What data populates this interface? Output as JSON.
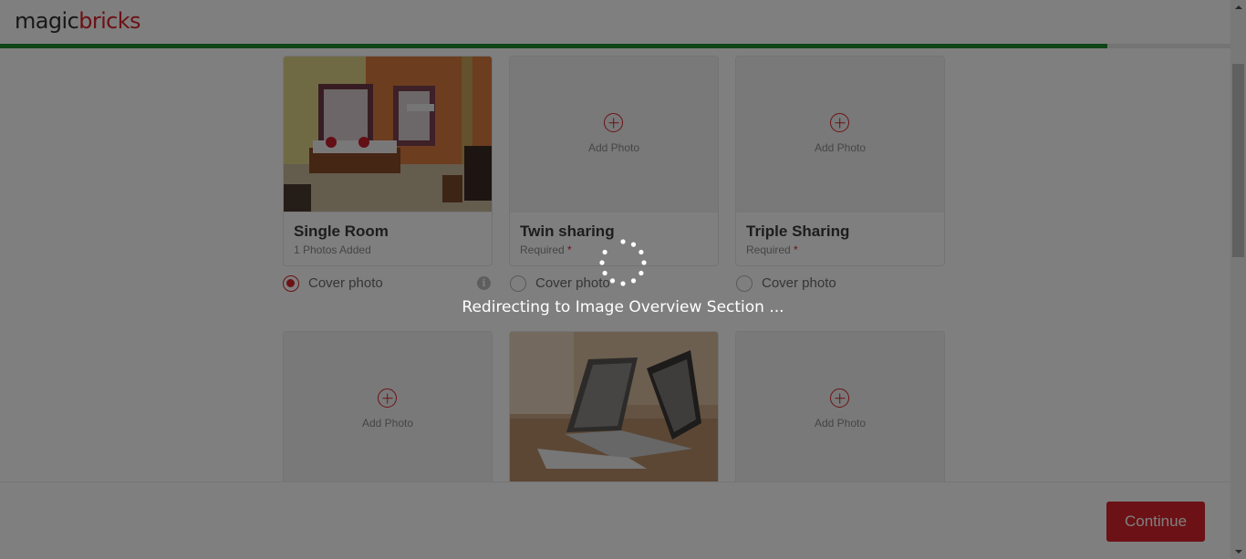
{
  "header": {
    "logo_part1": "magic",
    "logo_part2": "bricks",
    "progress_percent": 90
  },
  "photo_cards": [
    {
      "title": "Single Room",
      "subtitle": "1 Photos Added",
      "required_mark": "",
      "has_photo": true,
      "photo_desc": "bedroom-photo"
    },
    {
      "title": "Twin sharing",
      "subtitle": "Required",
      "required_mark": "*",
      "has_photo": false,
      "add_label": "Add Photo"
    },
    {
      "title": "Triple Sharing",
      "subtitle": "Required",
      "required_mark": "*",
      "has_photo": false,
      "add_label": "Add Photo"
    },
    {
      "has_photo": false,
      "add_label": "Add Photo"
    },
    {
      "has_photo": true,
      "photo_desc": "laptop-photo"
    },
    {
      "has_photo": false,
      "add_label": "Add Photo"
    }
  ],
  "cover_row": [
    {
      "label": "Cover photo",
      "checked": true,
      "info_icon": "i"
    },
    {
      "label": "Cover photo",
      "checked": false
    },
    {
      "label": "Cover photo",
      "checked": false
    }
  ],
  "footer": {
    "continue_label": "Continue"
  },
  "overlay": {
    "message": "Redirecting to Image Overview Section ..."
  },
  "colors": {
    "brand_red": "#d8232a",
    "progress_green": "#1f8a2e",
    "overlay": "rgba(0,0,0,0.5)"
  },
  "icons": {
    "add": "plus-circle-icon",
    "info": "info-icon",
    "spinner": "loading-spinner-icon"
  }
}
